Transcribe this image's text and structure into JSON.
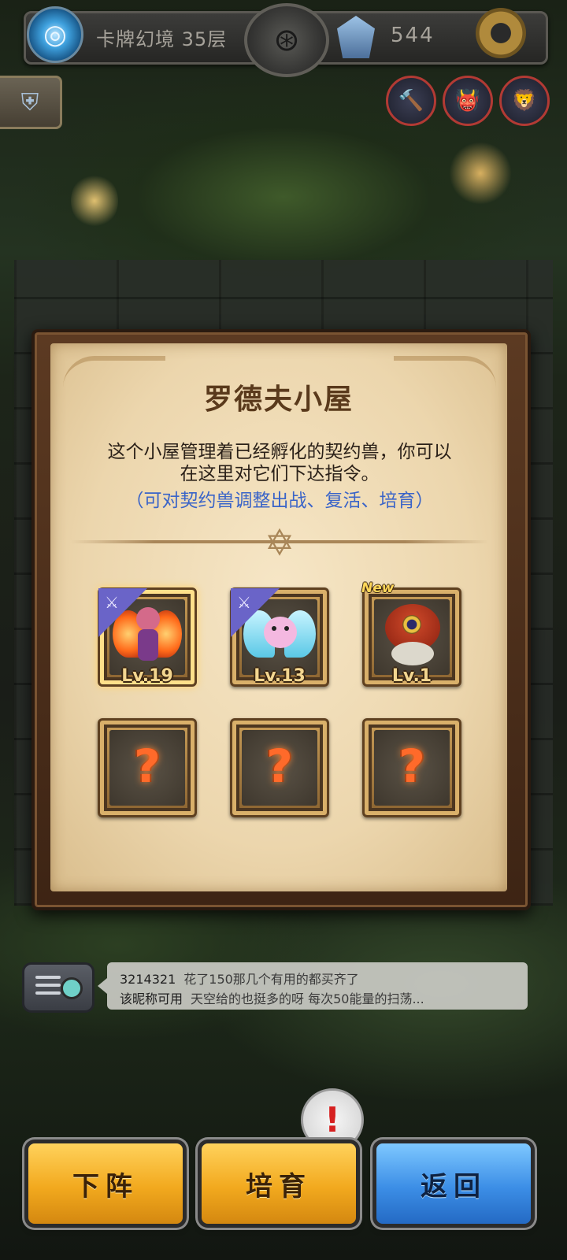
{
  "header": {
    "floor_label": "卡牌幻境 35层",
    "energy_value": "544"
  },
  "panel": {
    "title": "罗德夫小屋",
    "description_line1": "这个小屋管理着已经孵化的契约兽，你可以",
    "description_line2": "在这里对它们下达指令。",
    "hint": "（可对契约兽调整出战、复活、培育）",
    "slots": [
      {
        "level": "Lv.19",
        "deployed": true,
        "selected": true,
        "creature": "fire-fairy-creature"
      },
      {
        "level": "Lv.13",
        "deployed": true,
        "selected": false,
        "creature": "pink-winged-creature"
      },
      {
        "level": "Lv.1",
        "deployed": false,
        "selected": false,
        "tag": "New",
        "creature": "red-hooded-creature"
      },
      {
        "locked_symbol": "?"
      },
      {
        "locked_symbol": "?"
      },
      {
        "locked_symbol": "?"
      }
    ]
  },
  "chat": {
    "lines": [
      {
        "user": "3214321",
        "message": "花了150那几个有用的都买齐了"
      },
      {
        "user": "该昵称可用",
        "message": "天空给的也挺多的呀   每次50能量的扫荡..."
      }
    ]
  },
  "bottom": {
    "alert_symbol": "!",
    "undeploy_label": "下阵",
    "train_label": "培育",
    "back_label": "返回"
  },
  "colors": {
    "gold_button": "#f2a91e",
    "blue_button": "#3c8ee6",
    "hint_text": "#3a64c8",
    "title_text": "#5a3a1c"
  }
}
